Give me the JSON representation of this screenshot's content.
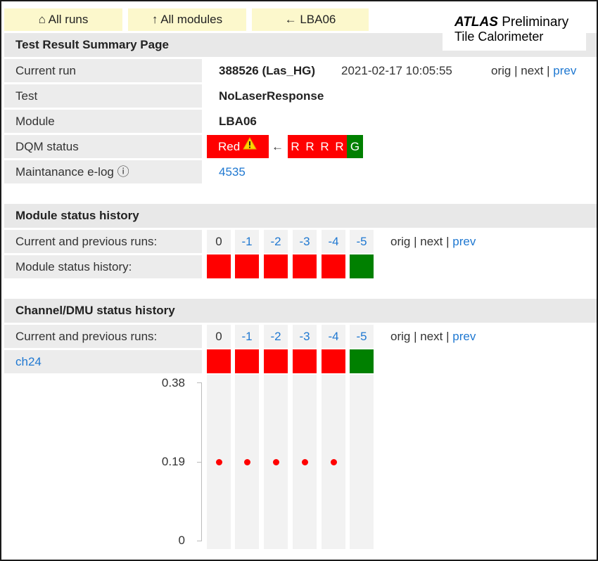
{
  "nav": {
    "all_runs": "⌂ All runs",
    "all_modules": "↑ All modules",
    "back_module": "← LBA06"
  },
  "watermark": {
    "atlas": "ATLAS",
    "preliminary": "Preliminary",
    "subtitle": "Tile Calorimeter"
  },
  "summary": {
    "title": "Test Result Summary Page",
    "current_run_label": "Current run",
    "current_run_value": "388526 (Las_HG)",
    "current_run_datetime": "2021-02-17 10:05:55",
    "test_label": "Test",
    "test_value": "NoLaserResponse",
    "module_label": "Module",
    "module_value": "LBA06",
    "dqm_label": "DQM status",
    "dqm_value": "Red",
    "dqm_arrow": "←",
    "dqm_history": [
      "R",
      "R",
      "R",
      "R",
      "G"
    ],
    "elog_label": "Maintanance e-log ⓘ",
    "elog_value": "4535"
  },
  "nav_links": {
    "orig": "orig",
    "sep1": " | ",
    "next": "next",
    "sep2": " | ",
    "prev": "prev"
  },
  "module_history": {
    "title": "Module status history",
    "runs_label": "Current and previous runs:",
    "status_label": "Module status history:",
    "runs": [
      "0",
      "-1",
      "-2",
      "-3",
      "-4",
      "-5"
    ],
    "statuses": [
      "red",
      "red",
      "red",
      "red",
      "red",
      "green"
    ]
  },
  "channel_history": {
    "title": "Channel/DMU status history",
    "runs_label": "Current and previous runs:",
    "channel_label": "ch24",
    "runs": [
      "0",
      "-1",
      "-2",
      "-3",
      "-4",
      "-5"
    ],
    "statuses": [
      "red",
      "red",
      "red",
      "red",
      "red",
      "green"
    ]
  },
  "colors": {
    "red": "#ff0000",
    "green": "#008000",
    "link": "#1f78d1"
  },
  "chart_data": {
    "type": "scatter",
    "x": [
      "0",
      "-1",
      "-2",
      "-3",
      "-4",
      "-5"
    ],
    "values": [
      0.19,
      0.19,
      0.19,
      0.19,
      0.19,
      null
    ],
    "yticks": [
      "0.38",
      "0.19",
      "0"
    ],
    "ylim": [
      0,
      0.38
    ]
  }
}
